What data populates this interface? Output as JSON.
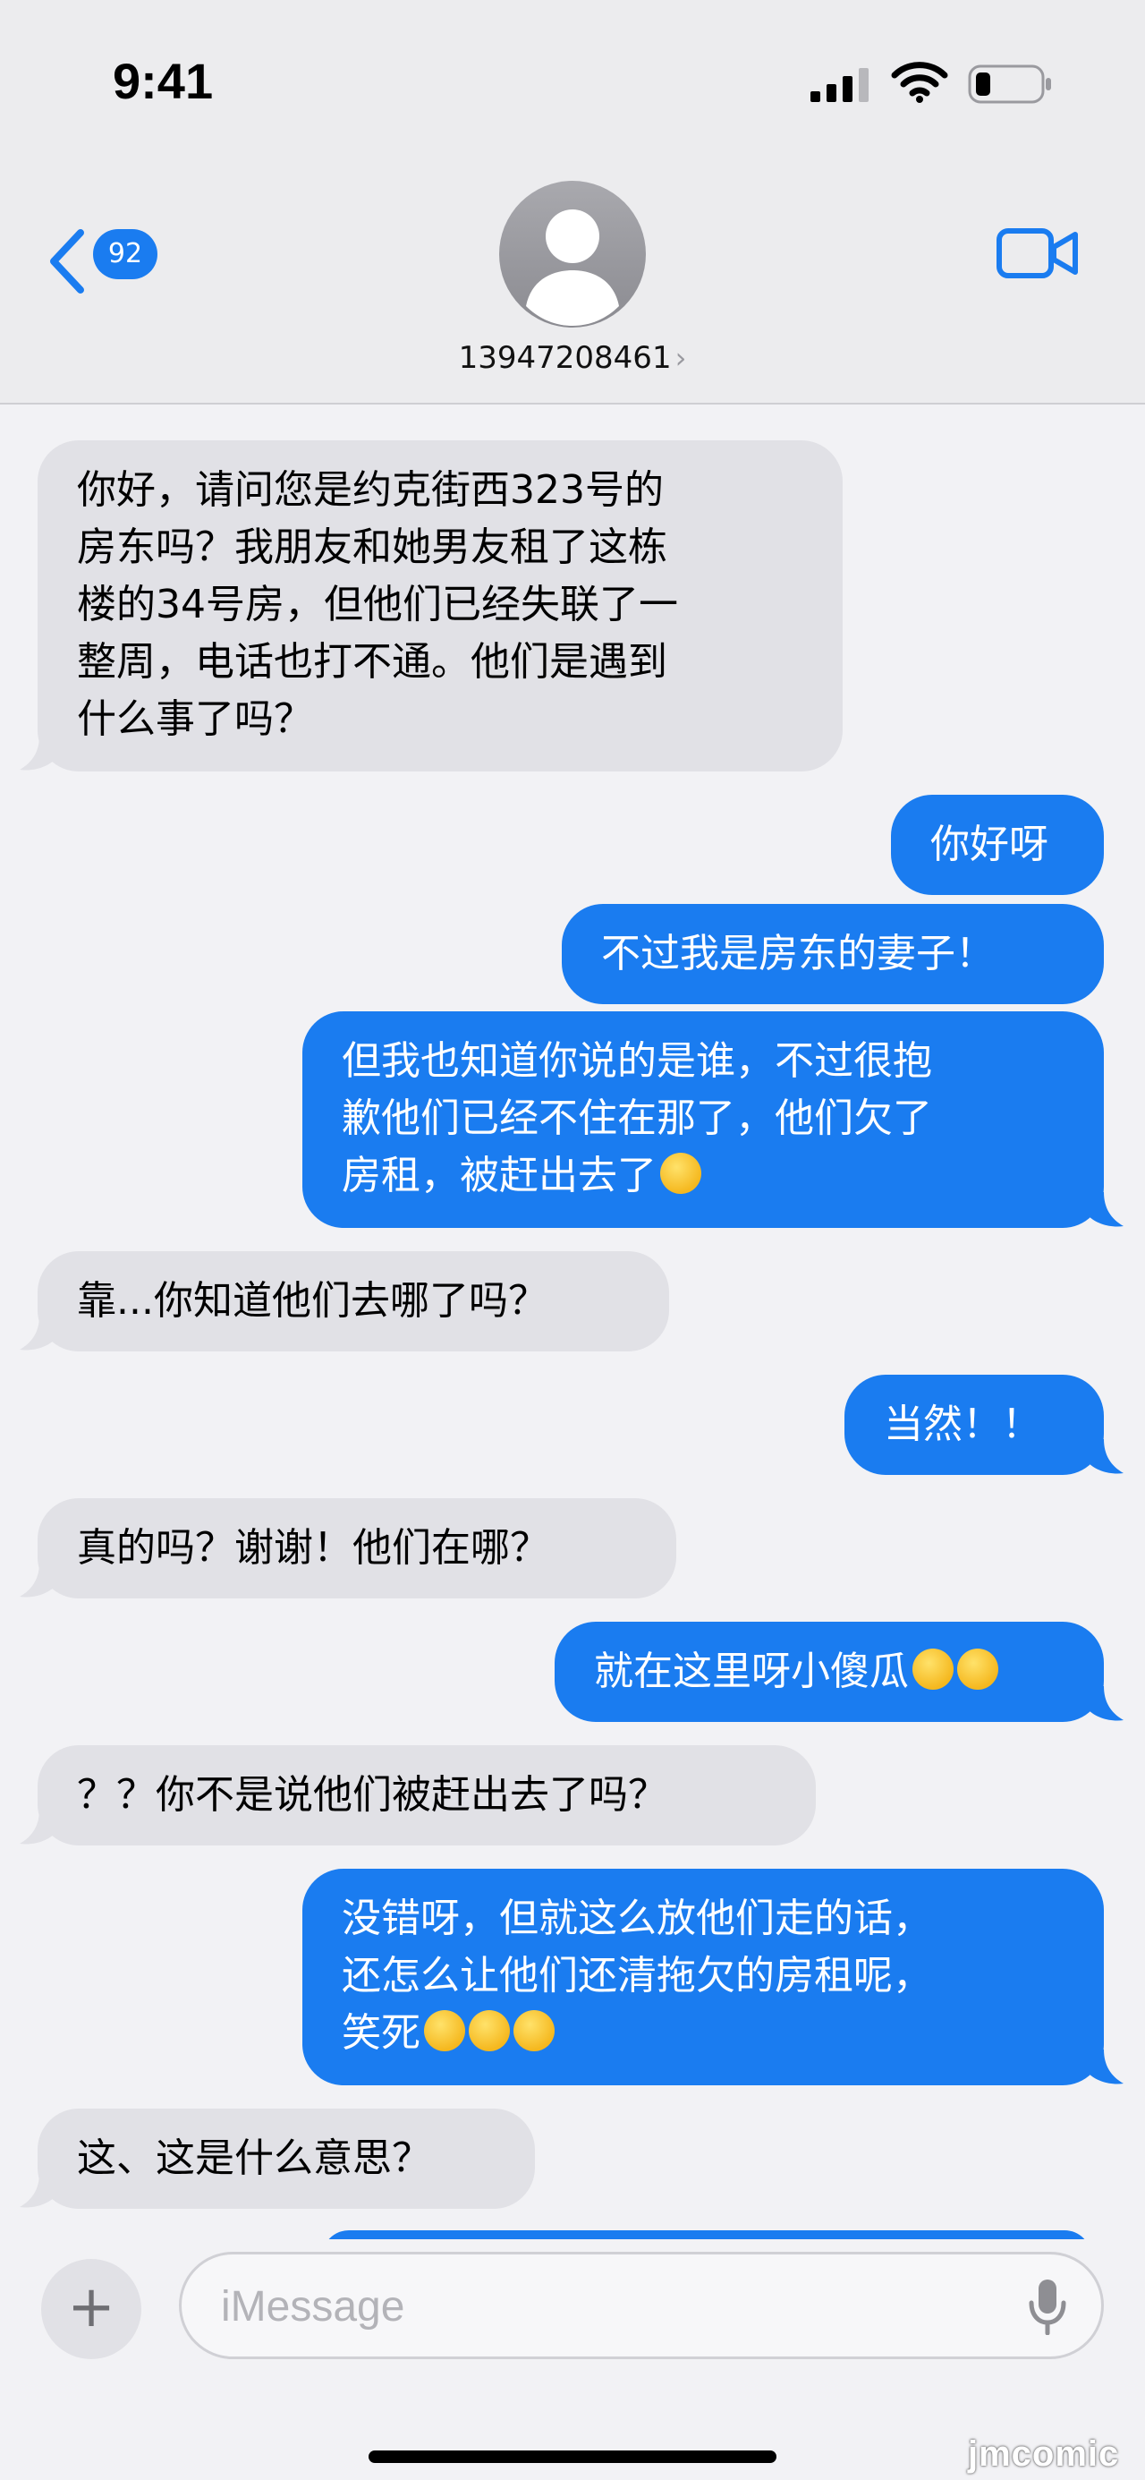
{
  "status_bar": {
    "time": "9:41"
  },
  "header": {
    "back_badge": "92",
    "contact_name": "13947208461",
    "contact_chevron": "›"
  },
  "messages": [
    {
      "direction": "incoming",
      "text": "你好，请问您是约克街西323号的\n房东吗？我朋友和她男友租了这栋\n楼的34号房，但他们已经失联了一\n整周，电话也打不通。他们是遇到\n什么事了吗？"
    },
    {
      "direction": "outgoing",
      "text": "你好呀"
    },
    {
      "direction": "outgoing",
      "text": "不过我是房东的妻子！"
    },
    {
      "direction": "outgoing",
      "text": "但我也知道你说的是谁，不过很抱\n歉他们已经不住在那了，他们欠了\n房租，被赶出去了",
      "emoji": [
        "grinning-sweat-emoji"
      ]
    },
    {
      "direction": "incoming",
      "text": "靠...你知道他们去哪了吗？"
    },
    {
      "direction": "outgoing",
      "text": "当然！！"
    },
    {
      "direction": "incoming",
      "text": "真的吗？谢谢！他们在哪？"
    },
    {
      "direction": "outgoing",
      "text": "就在这里呀小傻瓜",
      "emoji": [
        "yum-emoji",
        "yum-emoji"
      ]
    },
    {
      "direction": "incoming",
      "text": "？？你不是说他们被赶出去了吗？"
    },
    {
      "direction": "outgoing",
      "text": "没错呀，但就这么放他们走的话，\n还怎么让他们还清拖欠的房租呢，\n笑死",
      "emoji": [
        "tears-of-joy-emoji",
        "tears-of-joy-emoji",
        "tears-of-joy-emoji"
      ]
    },
    {
      "direction": "incoming",
      "text": "这、这是什么意思？"
    }
  ],
  "input": {
    "placeholder": "iMessage",
    "plus_label": "+"
  },
  "watermark": "jmcomic",
  "colors": {
    "outgoing_bubble": "#1a7cf0",
    "incoming_bubble": "#e1e1e6",
    "accent": "#1a7cf0"
  },
  "icons": [
    "back-chevron-icon",
    "avatar-icon",
    "video-call-icon",
    "signal-icon",
    "wifi-icon",
    "battery-icon",
    "microphone-icon",
    "plus-icon"
  ]
}
